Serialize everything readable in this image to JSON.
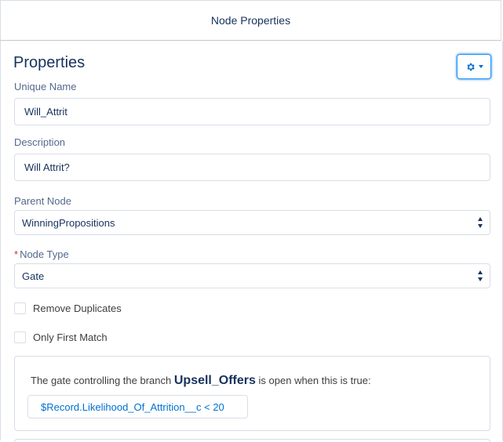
{
  "modal": {
    "title": "Node Properties"
  },
  "properties": {
    "heading": "Properties",
    "settings_icon": "gear-icon",
    "unique_name": {
      "label": "Unique Name",
      "value": "Will_Attrit"
    },
    "description": {
      "label": "Description",
      "value": "Will Attrit?"
    },
    "parent_node": {
      "label": "Parent Node",
      "value": "WinningPropositions"
    },
    "node_type": {
      "required_marker": "*",
      "label": "Node Type",
      "value": "Gate"
    },
    "remove_duplicates": {
      "label": "Remove Duplicates",
      "checked": false
    },
    "only_first_match": {
      "label": "Only First Match",
      "checked": false
    }
  },
  "gate": {
    "text_before": "The gate controlling the branch",
    "branch": "Upsell_Offers",
    "text_after": "is open when this is true:",
    "expression": "$Record.Likelihood_Of_Attrition__c < 20"
  },
  "colors": {
    "accent": "#0070d2",
    "border": "#d8dde6",
    "heading": "#16325c",
    "required": "#c23934"
  }
}
